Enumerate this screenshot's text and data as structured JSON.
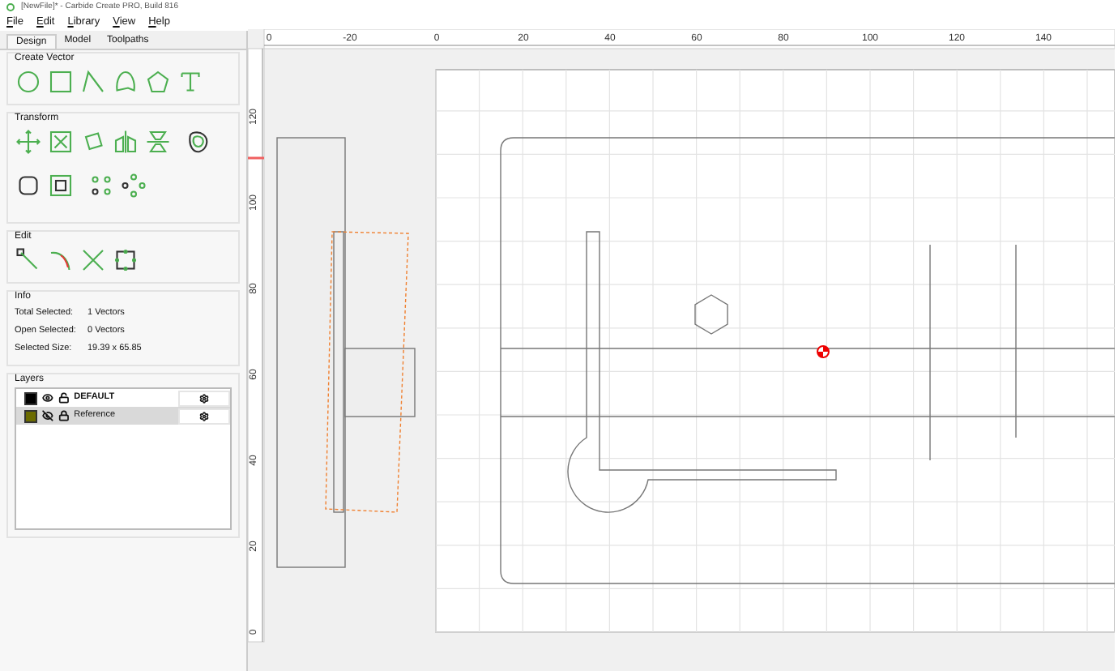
{
  "window": {
    "title": "[NewFile]* - Carbide Create PRO, Build 816"
  },
  "menu": [
    "File",
    "Edit",
    "Library",
    "View",
    "Help"
  ],
  "tabs": [
    {
      "label": "Design",
      "selected": true
    },
    {
      "label": "Model",
      "selected": false
    },
    {
      "label": "Toolpaths",
      "selected": false
    }
  ],
  "sections": [
    {
      "kind": "create_vector",
      "title": "Create Vector"
    },
    {
      "kind": "transform",
      "title": "Transform"
    },
    {
      "kind": "edit",
      "title": "Edit"
    }
  ],
  "info": {
    "title": "Info",
    "rows": [
      {
        "label": "Total Selected:",
        "value": "1 Vectors"
      },
      {
        "label": "Open Selected:",
        "value": "0 Vectors"
      },
      {
        "label": "Selected Size:",
        "value": "19.39 x 65.85"
      }
    ]
  },
  "layers": {
    "title": "Layers",
    "items": [
      {
        "name": "DEFAULT",
        "color": "#000000",
        "visible": true,
        "locked": false,
        "selected": false
      },
      {
        "name": "Reference",
        "color": "#6b6b00",
        "visible": false,
        "locked": true,
        "selected": true
      }
    ]
  },
  "x_ruler": [
    "0",
    "-20",
    "0",
    "20",
    "40",
    "60",
    "80",
    "100",
    "120",
    "140"
  ],
  "y_ruler": [
    "120",
    "100",
    "80",
    "60",
    "40",
    "20",
    "0"
  ]
}
